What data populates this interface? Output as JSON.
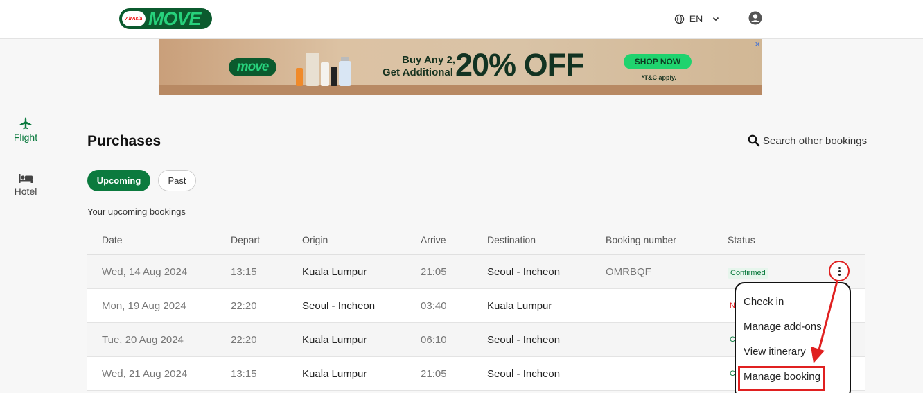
{
  "header": {
    "logo_badge": "AirAsia",
    "logo_word": "MOVE",
    "language": "EN"
  },
  "banner": {
    "logo": "move",
    "line1": "Buy Any 2,",
    "line2": "Get Additional",
    "big": "20% OFF",
    "button": "SHOP NOW",
    "tnc": "*T&C apply.",
    "close": "×"
  },
  "sidebar": {
    "items": [
      {
        "label": "Flight",
        "icon": "plane-icon",
        "active": true
      },
      {
        "label": "Hotel",
        "icon": "bed-icon",
        "active": false
      }
    ]
  },
  "main": {
    "title": "Purchases",
    "search_label": "Search other bookings",
    "tabs": [
      {
        "label": "Upcoming",
        "active": true
      },
      {
        "label": "Past",
        "active": false
      }
    ],
    "subtitle": "Your upcoming bookings"
  },
  "table": {
    "headers": [
      "Date",
      "Depart",
      "Origin",
      "Arrive",
      "Destination",
      "Booking number",
      "Status"
    ],
    "rows": [
      {
        "date": "Wed, 14 Aug 2024",
        "depart": "13:15",
        "origin": "Kuala Lumpur",
        "arrive": "21:05",
        "destination": "Seoul - Incheon",
        "booking_number": "OMRBQF",
        "status": "Confirmed"
      },
      {
        "date": "Mon, 19 Aug 2024",
        "depart": "22:20",
        "origin": "Seoul - Incheon",
        "arrive": "03:40",
        "destination": "Kuala Lumpur",
        "booking_number": "",
        "status": "N"
      },
      {
        "date": "Tue, 20 Aug 2024",
        "depart": "22:20",
        "origin": "Kuala Lumpur",
        "arrive": "06:10",
        "destination": "Seoul - Incheon",
        "booking_number": "",
        "status": "C"
      },
      {
        "date": "Wed, 21 Aug 2024",
        "depart": "13:15",
        "origin": "Kuala Lumpur",
        "arrive": "21:05",
        "destination": "Seoul - Incheon",
        "booking_number": "",
        "status": "C"
      }
    ]
  },
  "menu": {
    "items": [
      "Check in",
      "Manage add-ons",
      "View itinerary",
      "Manage booking"
    ]
  },
  "colors": {
    "brand_green": "#0b7a3e",
    "accent_red": "#e02020"
  }
}
